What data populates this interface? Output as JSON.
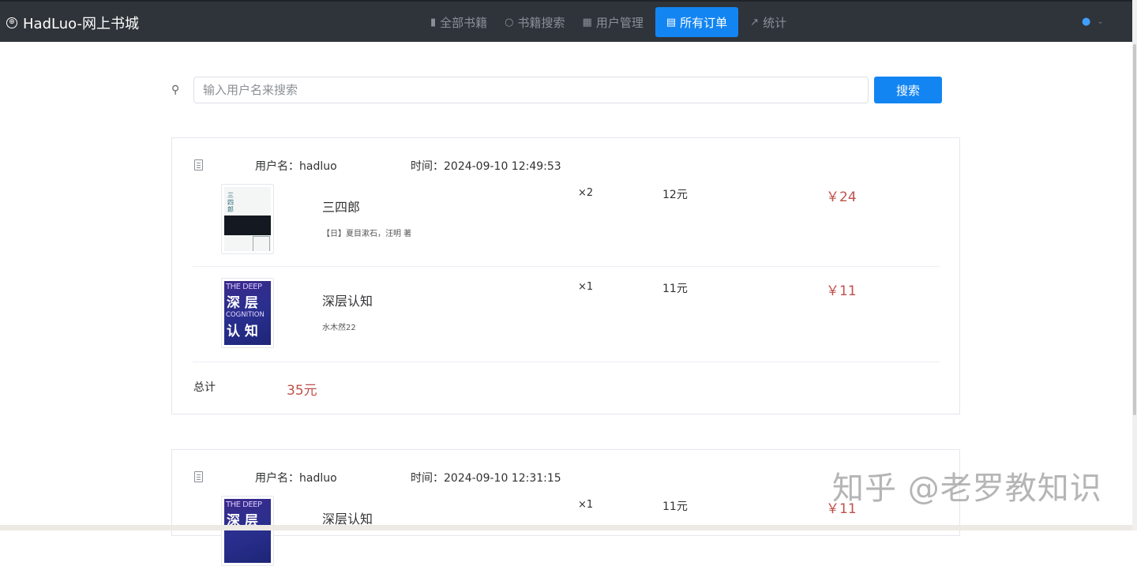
{
  "app": {
    "title": "HadLuo-网上书城"
  },
  "nav": {
    "items": [
      {
        "label": "全部书籍",
        "icon": "book-icon"
      },
      {
        "label": "书籍搜索",
        "icon": "search-icon"
      },
      {
        "label": "用户管理",
        "icon": "grid-icon"
      },
      {
        "label": "所有订单",
        "icon": "document-icon",
        "active": true
      },
      {
        "label": "统计",
        "icon": "chart-line-icon"
      }
    ]
  },
  "search": {
    "placeholder": "输入用户名来搜索",
    "value": "",
    "button_label": "搜索"
  },
  "orders": [
    {
      "user_label": "用户名：hadluo",
      "time_label": "时间：2024-09-10 12:49:53",
      "items": [
        {
          "title": "三四郎",
          "author": "【日】夏目漱石，汪明 著",
          "qty": "×2",
          "price": "12元",
          "subtotal": "￥24",
          "cover": {
            "title": "三四郎"
          }
        },
        {
          "title": "深层认知",
          "author": "水木然22",
          "qty": "×1",
          "price": "11元",
          "subtotal": "￥11",
          "cover": {
            "line1": "THE DEEP",
            "line2": "深 层",
            "line3": "COGNITION",
            "line4": "认 知"
          }
        }
      ],
      "total_label": "总计",
      "total_value": "35元"
    },
    {
      "user_label": "用户名：hadluo",
      "time_label": "时间：2024-09-10 12:31:15",
      "items": [
        {
          "title": "深层认知",
          "qty": "×1",
          "price": "11元",
          "subtotal": "￥11",
          "cover": {
            "line1": "THE DEEP",
            "line2": "深 层"
          }
        }
      ]
    }
  ],
  "watermark": "知乎 @老罗教知识",
  "colors": {
    "topbar": "#2f343a",
    "accent": "#1385f2",
    "price_red": "#c0504d"
  }
}
